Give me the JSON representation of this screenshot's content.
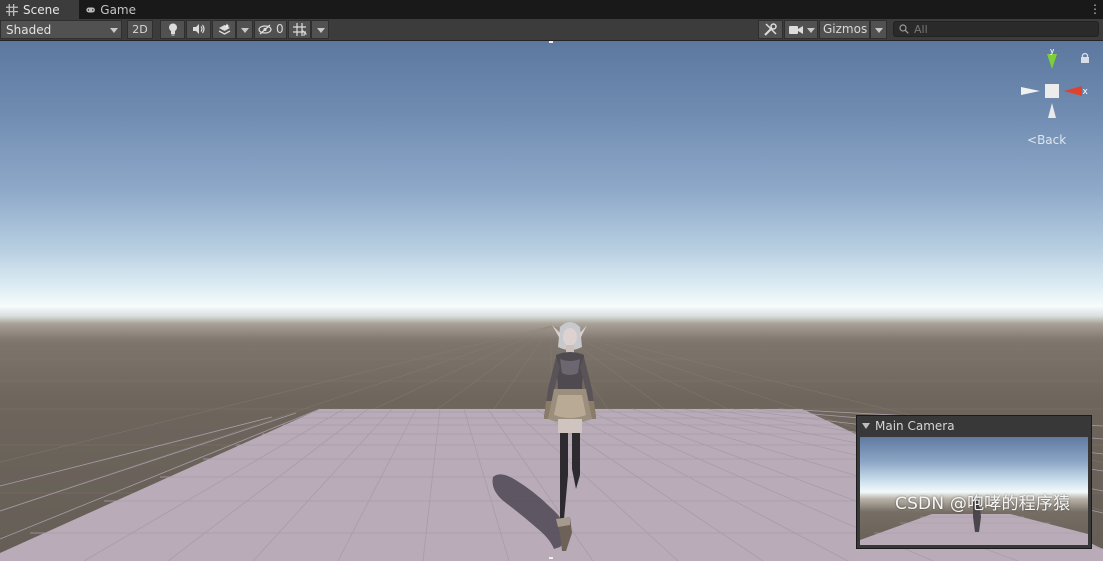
{
  "tabs": [
    {
      "label": "Scene",
      "icon": "grid-icon",
      "active": true
    },
    {
      "label": "Game",
      "icon": "gamepad-icon",
      "active": false
    }
  ],
  "toolbar": {
    "shading_mode": "Shaded",
    "mode_2d_label": "2D",
    "hidden_count": "0",
    "gizmos_label": "Gizmos",
    "search_placeholder": "All"
  },
  "viewport": {
    "orientation_label": "Back",
    "axis_y_label": "y",
    "axis_x_label": "x",
    "axis_y_color": "#7ccf35",
    "axis_x_color": "#e0422c"
  },
  "camera_preview": {
    "title": "Main Camera"
  },
  "watermark": "CSDN @咆哮的程序猿",
  "colors": {
    "tab_bar": "#191919",
    "toolbar": "#3c3c3c",
    "button": "#515151",
    "ground_plane": "#b9acb8"
  }
}
